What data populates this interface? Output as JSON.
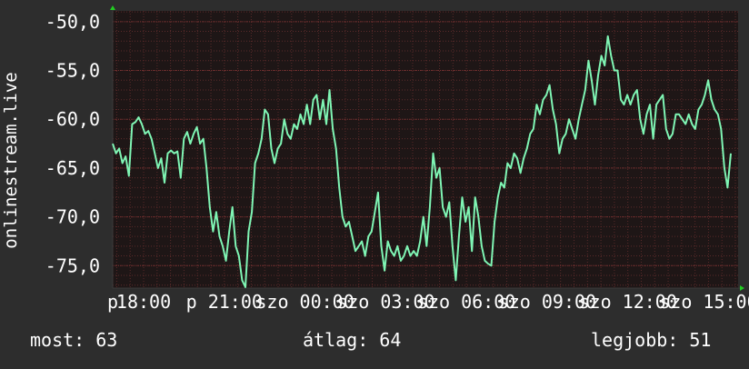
{
  "chart_data": {
    "type": "line",
    "ylabel": "onlinestream.live",
    "ylim": [
      -77.3,
      -48.9
    ],
    "yticks": [
      -50,
      -55,
      -60,
      -65,
      -70,
      -75
    ],
    "ytick_labels": [
      "-50,0",
      "-55,0",
      "-60,0",
      "-65,0",
      "-70,0",
      "-75,0"
    ],
    "xlim": [
      16.9,
      16.9
    ],
    "xticks": [
      16.9,
      18,
      21,
      24,
      27,
      30,
      33,
      36,
      39
    ],
    "xtick_labels": [
      "p",
      "18:00",
      "p 21:00",
      "szo 00:00",
      "szo 03:00",
      "szo 06:00",
      "szo 09:00",
      "szo 12:00",
      "szo 15:00"
    ],
    "x_range_hours": [
      16.85,
      40.1
    ],
    "grid": true,
    "line_color": "#7ff5b4",
    "series": [
      {
        "values": [
          -62.5,
          -63.5,
          -63.0,
          -64.5,
          -63.8,
          -65.8,
          -60.5,
          -60.3,
          -59.8,
          -60.5,
          -61.5,
          -61.2,
          -62.0,
          -63.5,
          -65.0,
          -64.0,
          -66.5,
          -63.5,
          -63.2,
          -63.5,
          -63.3,
          -66.0,
          -62.0,
          -61.3,
          -62.5,
          -61.5,
          -60.8,
          -62.5,
          -62.0,
          -65.0,
          -69.0,
          -71.5,
          -69.5,
          -72.0,
          -73.0,
          -74.5,
          -71.5,
          -69.0,
          -73.0,
          -74.0,
          -76.5,
          -77.2,
          -71.5,
          -69.5,
          -64.5,
          -63.5,
          -62.0,
          -59.0,
          -59.5,
          -63.0,
          -64.5,
          -63.0,
          -62.5,
          -60.0,
          -61.5,
          -62.0,
          -60.5,
          -61.0,
          -59.5,
          -60.5,
          -58.5,
          -60.5,
          -58.0,
          -57.5,
          -60.0,
          -58.0,
          -60.5,
          -57.0,
          -61.0,
          -63.0,
          -67.0,
          -70.0,
          -71.0,
          -70.5,
          -72.0,
          -73.5,
          -73.0,
          -72.5,
          -74.0,
          -72.0,
          -71.5,
          -69.5,
          -67.5,
          -73.0,
          -75.5,
          -72.5,
          -73.5,
          -74.0,
          -73.0,
          -74.5,
          -74.0,
          -73.0,
          -74.0,
          -73.5,
          -74.0,
          -72.5,
          -70.0,
          -73.0,
          -69.0,
          -63.5,
          -66.0,
          -65.0,
          -69.0,
          -70.0,
          -68.5,
          -73.0,
          -76.5,
          -72.0,
          -68.0,
          -70.5,
          -69.0,
          -73.5,
          -68.0,
          -70.0,
          -73.0,
          -74.5,
          -74.8,
          -75.0,
          -70.5,
          -68.0,
          -66.5,
          -67.0,
          -64.5,
          -65.0,
          -63.5,
          -64.0,
          -65.5,
          -64.0,
          -63.0,
          -61.5,
          -61.0,
          -58.5,
          -59.5,
          -58.0,
          -57.5,
          -56.5,
          -59.0,
          -60.5,
          -63.5,
          -62.0,
          -61.5,
          -60.0,
          -61.0,
          -62.0,
          -60.0,
          -58.5,
          -57.0,
          -54.0,
          -56.0,
          -58.5,
          -55.5,
          -53.5,
          -54.5,
          -51.5,
          -53.5,
          -55.0,
          -55.0,
          -58.0,
          -58.5,
          -57.5,
          -58.5,
          -57.5,
          -57.0,
          -60.0,
          -61.5,
          -59.5,
          -58.5,
          -62.0,
          -58.5,
          -58.0,
          -57.5,
          -61.0,
          -62.0,
          -61.5,
          -59.5,
          -59.5,
          -60.0,
          -60.5,
          -59.5,
          -60.5,
          -61.0,
          -59.0,
          -58.5,
          -57.5,
          -56.0,
          -58.0,
          -59.0,
          -59.5,
          -61.0,
          -65.0,
          -67.0,
          -63.5
        ]
      }
    ]
  },
  "stats": {
    "now": "most: 63",
    "avg": "átlag: 64",
    "best": "legjobb: 51"
  }
}
